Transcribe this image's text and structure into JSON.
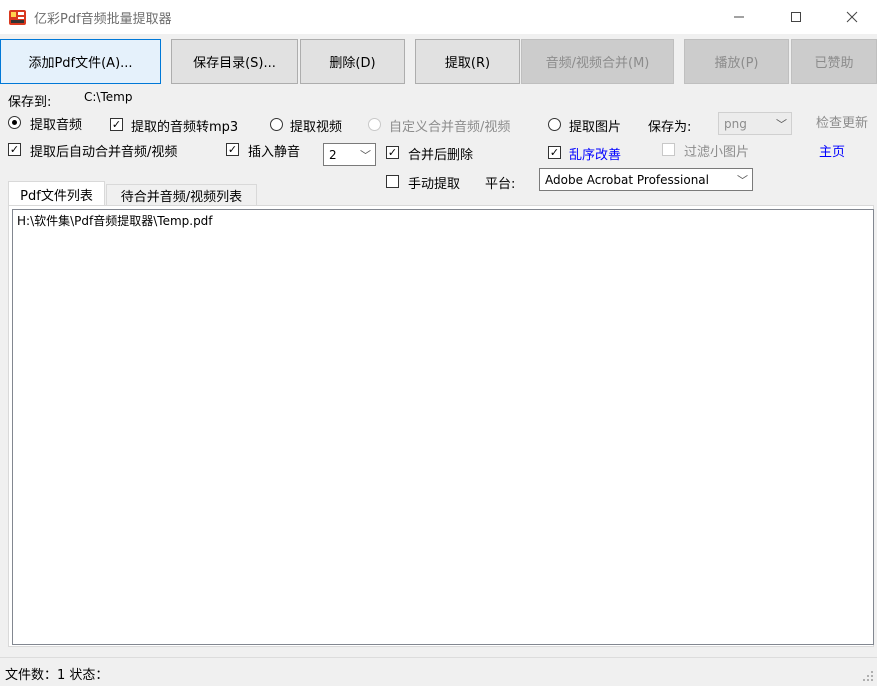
{
  "window": {
    "title": "亿彩Pdf音频批量提取器",
    "controls": {
      "minimize": "—",
      "maximize": "☐",
      "close": "✕"
    }
  },
  "toolbar": {
    "add_pdf": "添加Pdf文件(A)...",
    "save_dir": "保存目录(S)...",
    "delete": "删除(D)",
    "extract": "提取(R)",
    "merge": "音频/视频合并(M)",
    "play": "播放(P)",
    "sponsored": "已赞助"
  },
  "save_to": {
    "label": "保存到:",
    "path": "C:\\Temp"
  },
  "options": {
    "extract_audio": "提取音频",
    "convert_mp3": "提取的音频转mp3",
    "extract_video": "提取视频",
    "custom_merge": "自定义合并音频/视频",
    "extract_image": "提取图片",
    "save_as_label": "保存为:",
    "image_format": "png",
    "check_update": "检查更新",
    "auto_merge": "提取后自动合并音频/视频",
    "insert_silence": "插入静音",
    "silence_value": "2",
    "delete_after_merge": "合并后删除",
    "fix_garbled": "乱序改善",
    "filter_small": "过滤小图片",
    "homepage": "主页",
    "manual_extract": "手动提取",
    "platform_label": "平台:",
    "platform_value": "Adobe Acrobat Professional"
  },
  "state": {
    "extract_audio": true,
    "convert_mp3": true,
    "extract_video": false,
    "custom_merge": false,
    "extract_image": false,
    "auto_merge": true,
    "insert_silence": true,
    "delete_after_merge": true,
    "fix_garbled": true,
    "filter_small": false,
    "manual_extract": false
  },
  "tabs": [
    "Pdf文件列表",
    "待合并音频/视频列表"
  ],
  "file_list": [
    "H:\\软件集\\Pdf音频提取器\\Temp.pdf"
  ],
  "status": {
    "text": "文件数：1  状态："
  },
  "colors": {
    "link": "#0000ff",
    "accent": "#0078d7",
    "disabled": "#8c8c8c"
  }
}
